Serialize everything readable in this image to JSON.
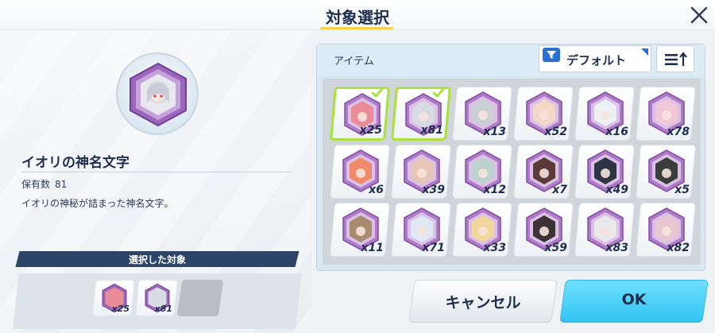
{
  "header": {
    "title": "対象選択",
    "close_icon": "close-icon"
  },
  "detail": {
    "item_name": "イオリの神名文字",
    "owned_label": "保有数",
    "owned_value": "81",
    "description": "イオリの神秘が詰まった神名文字。",
    "icon": "eleph-hex-icon"
  },
  "selection": {
    "header": "選択した対象",
    "slots": [
      {
        "count": "x25",
        "color": "#e98c97"
      },
      {
        "count": "x81",
        "color": "#d8dbe2"
      }
    ]
  },
  "list": {
    "label": "アイテム",
    "sort_label": "デフォルト",
    "filter_icon": "funnel-icon",
    "order_icon": "sort-ascending-icon",
    "accent": "#2a6fd6",
    "items": [
      {
        "count": "x25",
        "selected": true,
        "color": "#e98c97"
      },
      {
        "count": "x81",
        "selected": true,
        "color": "#d8dbe2"
      },
      {
        "count": "x13",
        "selected": false,
        "color": "#c9cfd4"
      },
      {
        "count": "x52",
        "selected": false,
        "color": "#f3d8c8"
      },
      {
        "count": "x16",
        "selected": false,
        "color": "#eef1f4"
      },
      {
        "count": "x78",
        "selected": false,
        "color": "#f2c8d8"
      },
      {
        "count": "x6",
        "selected": false,
        "color": "#f08a6a"
      },
      {
        "count": "x39",
        "selected": false,
        "color": "#e8c6b6"
      },
      {
        "count": "x12",
        "selected": false,
        "color": "#bcd2cf"
      },
      {
        "count": "x7",
        "selected": false,
        "color": "#5a3b3a"
      },
      {
        "count": "x49",
        "selected": false,
        "color": "#2f3444"
      },
      {
        "count": "x5",
        "selected": false,
        "color": "#3a3e3a"
      },
      {
        "count": "x11",
        "selected": false,
        "color": "#a88a6e"
      },
      {
        "count": "x71",
        "selected": false,
        "color": "#dfe8f4"
      },
      {
        "count": "x33",
        "selected": false,
        "color": "#f1d79a"
      },
      {
        "count": "x59",
        "selected": false,
        "color": "#3c3236"
      },
      {
        "count": "x83",
        "selected": false,
        "color": "#e9e9ec"
      },
      {
        "count": "x82",
        "selected": false,
        "color": "#e7c6cf"
      }
    ]
  },
  "buttons": {
    "cancel": "キャンセル",
    "ok": "OK"
  },
  "colors": {
    "hex_frame": "#b07ac9",
    "hex_frame_dark": "#7d4da0",
    "selected_border": "#a9e23c",
    "ok_bg": "#44c9f4"
  }
}
